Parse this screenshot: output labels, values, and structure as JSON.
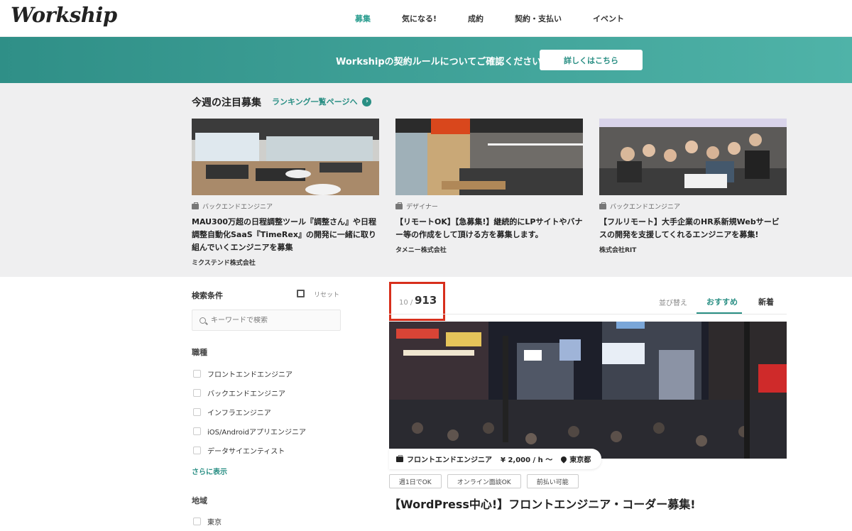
{
  "brand": "Workship",
  "nav": [
    "募集",
    "気になる!",
    "成約",
    "契約・支払い",
    "イベント"
  ],
  "banner": {
    "text": "Workshipの契約ルールについてご確認ください!",
    "button": "詳しくはこちら"
  },
  "featured": {
    "title": "今週の注目募集",
    "ranking_link": "ランキング一覧ページへ",
    "cards": [
      {
        "category": "バックエンドエンジニア",
        "title": "MAU300万超の日程調整ツール『調整さん』や日程調整自動化SaaS『TimeRex』の開発に一緒に取り組んでいくエンジニアを募集",
        "company": "ミクステンド株式会社"
      },
      {
        "category": "デザイナー",
        "title": "【リモートOK】【急募集!】継続的にLPサイトやバナー等の作成をして頂ける方を募集します。",
        "company": "タメニー株式会社"
      },
      {
        "category": "バックエンドエンジニア",
        "title": "【フルリモート】大手企業のHR系新規Webサービスの開発を支援してくれるエンジニアを募集!",
        "company": "株式会社RIT"
      }
    ]
  },
  "sidebar": {
    "title": "検索条件",
    "reset": "リセット",
    "search_placeholder": "キーワードで検索",
    "job_type_label": "職種",
    "job_types": [
      "フロントエンドエンジニア",
      "バックエンドエンジニア",
      "インフラエンジニア",
      "iOS/Androidアプリエンジニア",
      "データサイエンティスト"
    ],
    "more": "さらに表示",
    "region_label": "地域",
    "region_first": "東京"
  },
  "results": {
    "shown": "10",
    "separator": "/",
    "total": "913",
    "sort_label": "並び替え",
    "tab_recommend": "おすすめ",
    "tab_new": "新着"
  },
  "job": {
    "category": "フロントエンドエンジニア",
    "rate": "¥ 2,000 / h 〜",
    "location": "東京都",
    "tags": [
      "週1日でOK",
      "オンライン面談OK",
      "前払い可能"
    ],
    "title": "【WordPress中心!】フロントエンジニア・コーダー募集!"
  }
}
